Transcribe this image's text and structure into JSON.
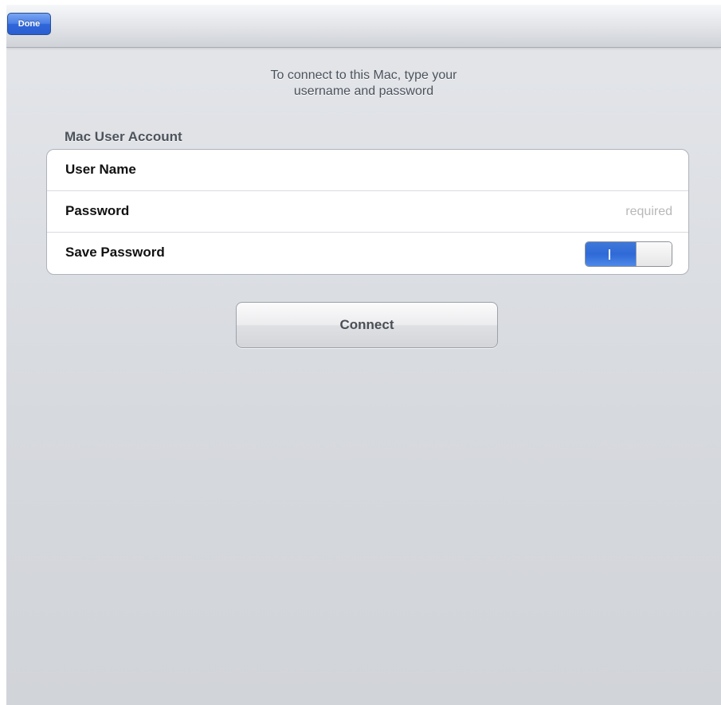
{
  "navbar": {
    "done_label": "Done"
  },
  "instructions": {
    "line1": "To connect to this Mac, type your",
    "line2": "username and password"
  },
  "account": {
    "section_header": "Mac User Account",
    "user_name_label": "User Name",
    "user_name_value": "",
    "password_label": "Password",
    "password_placeholder": "required",
    "save_password_label": "Save Password",
    "save_password_on": true
  },
  "connect_label": "Connect",
  "colors": {
    "accent_blue": "#2f6ad7",
    "background": "#d6d9de"
  }
}
